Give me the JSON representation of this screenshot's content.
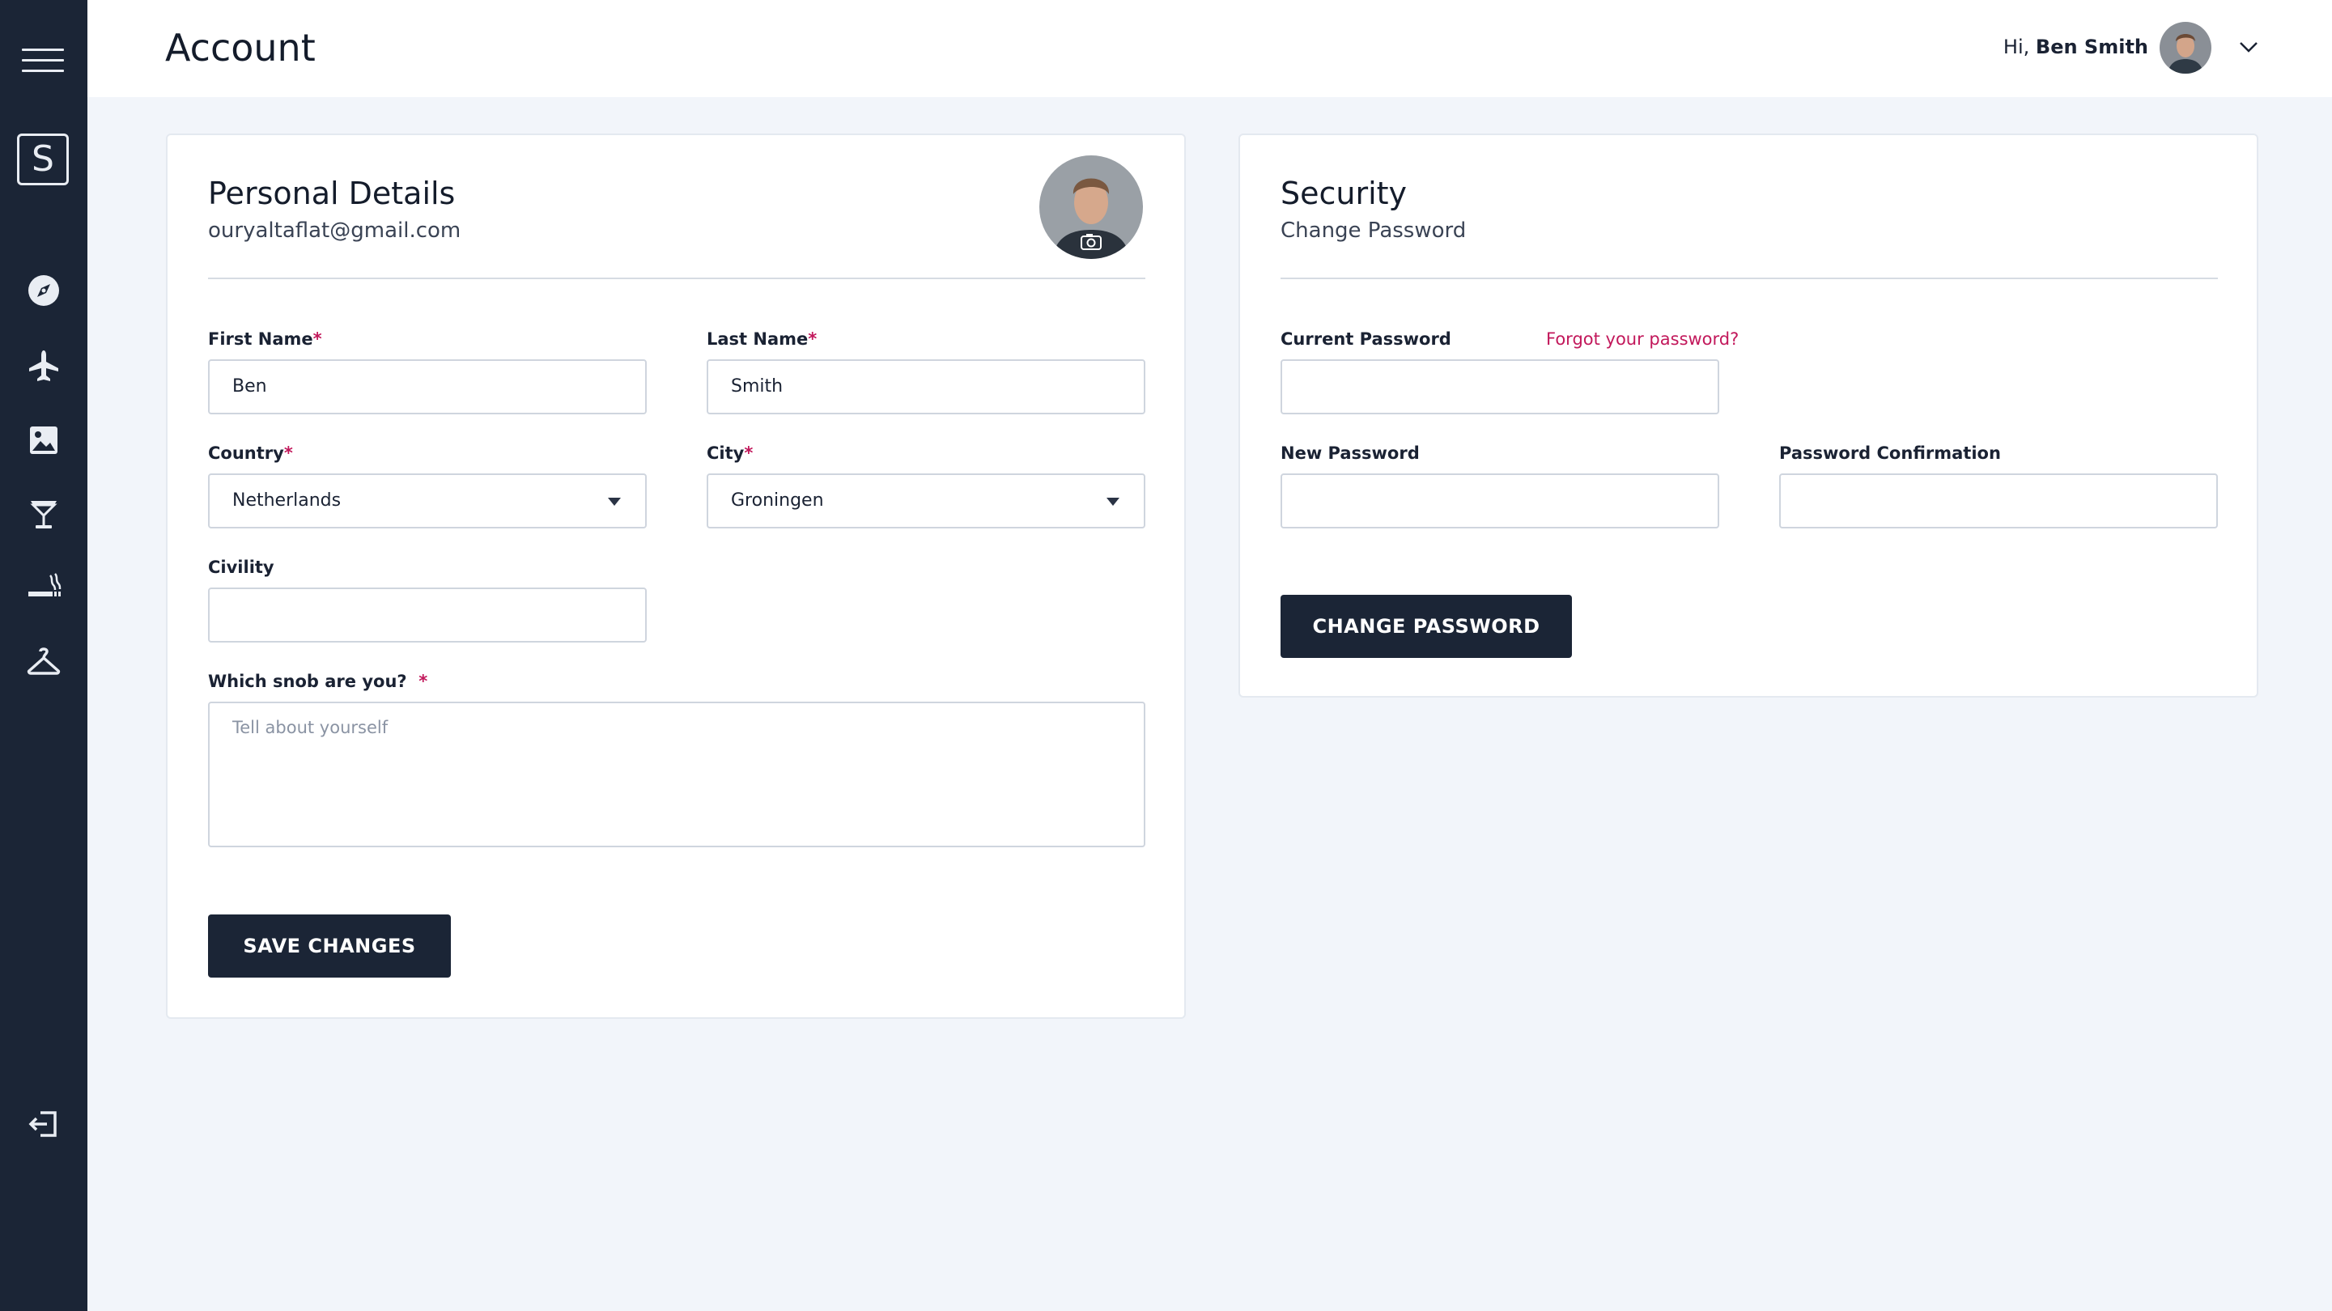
{
  "header": {
    "title": "Account",
    "greeting_prefix": "Hi, ",
    "user_name": "Ben Smith"
  },
  "sidebar": {
    "logo_letter": "S",
    "icons": [
      "menu-icon",
      "compass-icon",
      "airplane-icon",
      "image-icon",
      "cocktail-icon",
      "cigar-icon",
      "hanger-icon",
      "logout-icon"
    ]
  },
  "personal": {
    "title": "Personal Details",
    "email": "ouryaltaflat@gmail.com",
    "first_name_label": "First Name",
    "first_name_value": "Ben",
    "last_name_label": "Last Name",
    "last_name_value": "Smith",
    "country_label": "Country",
    "country_value": "Netherlands",
    "city_label": "City",
    "city_value": "Groningen",
    "civility_label": "Civility",
    "civility_value": "",
    "snob_label": "Which snob are you?",
    "snob_placeholder": "Tell about yourself",
    "required_mark": "*",
    "save_label": "SAVE CHANGES"
  },
  "security": {
    "title": "Security",
    "subtitle": "Change Password",
    "current_label": "Current Password",
    "forgot_label": "Forgot your password?",
    "new_label": "New Password",
    "confirm_label": "Password Confirmation",
    "change_label": "CHANGE PASSWORD"
  },
  "colors": {
    "sidebar": "#1b2536",
    "background": "#f2f5fa",
    "accent": "#c2185b",
    "button": "#1b2536"
  }
}
